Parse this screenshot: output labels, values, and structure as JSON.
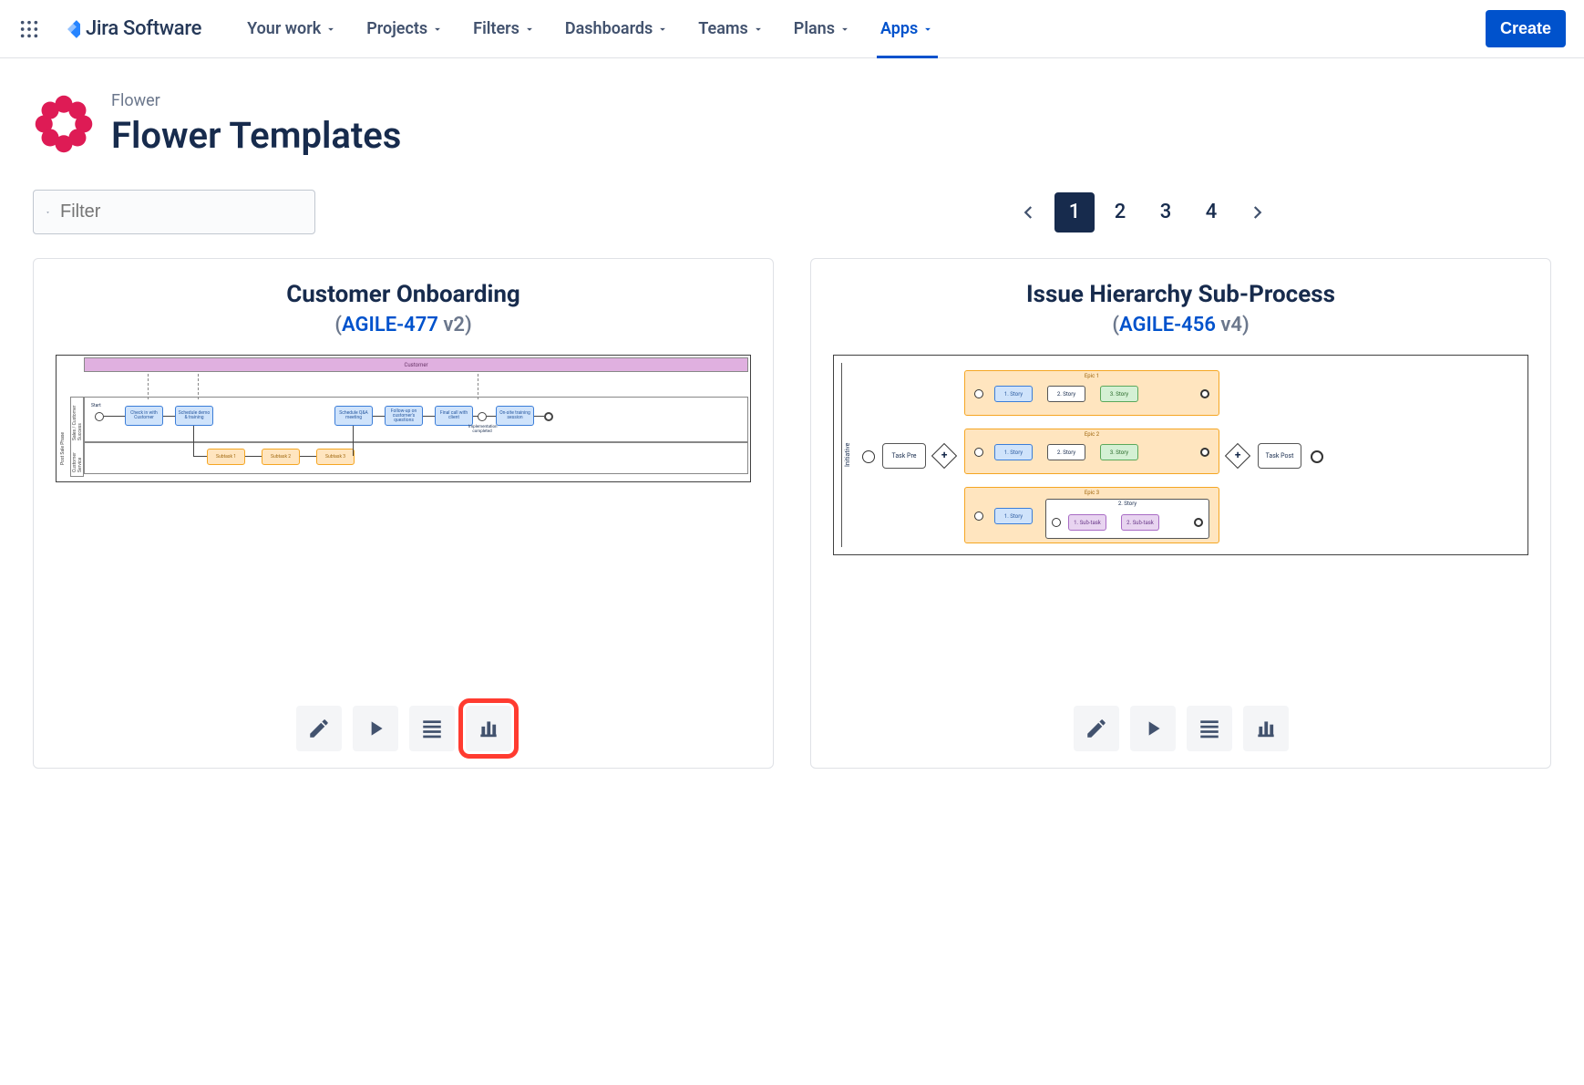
{
  "nav": {
    "product": "Jira Software",
    "items": [
      "Your work",
      "Projects",
      "Filters",
      "Dashboards",
      "Teams",
      "Plans",
      "Apps"
    ],
    "active_index": 6,
    "create": "Create"
  },
  "page": {
    "breadcrumb": "Flower",
    "title": "Flower Templates"
  },
  "filter": {
    "placeholder": "Filter"
  },
  "pagination": {
    "pages": [
      "1",
      "2",
      "3",
      "4"
    ],
    "current": 0
  },
  "cards": [
    {
      "title": "Customer Onboarding",
      "issue_key": "AGILE-477",
      "version": "v2",
      "diagram": {
        "pool_top": "Customer",
        "outer_lane": "Post Sale Phase",
        "lane1": "Sales / Customer Success",
        "lane2": "Customer Service",
        "start": "Start",
        "blue_nodes": [
          "Check in with Customer",
          "Schedule demo & training",
          "Schedule Q&A meeting",
          "Follow-up on customer's questions",
          "Final call with client",
          "On-site training session"
        ],
        "orange_nodes": [
          "Subtask 1",
          "Subtask 2",
          "Subtask 3"
        ],
        "annotation": "Implementation completed"
      }
    },
    {
      "title": "Issue Hierarchy Sub-Process",
      "issue_key": "AGILE-456",
      "version": "v4",
      "diagram": {
        "lane": "Initiative",
        "task_pre": "Task Pre",
        "task_post": "Task Post",
        "epics": [
          {
            "name": "Epic 1",
            "stories": [
              {
                "l": "1. Story",
                "c": "blue"
              },
              {
                "l": "2. Story",
                "c": "white"
              },
              {
                "l": "3. Story",
                "c": "green"
              }
            ]
          },
          {
            "name": "Epic 2",
            "stories": [
              {
                "l": "1. Story",
                "c": "blue"
              },
              {
                "l": "2. Story",
                "c": "white"
              },
              {
                "l": "3. Story",
                "c": "green"
              }
            ]
          },
          {
            "name": "Epic 3",
            "stories": [
              {
                "l": "1. Story",
                "c": "blue"
              }
            ],
            "nested": {
              "label": "2. Story",
              "subtasks": [
                {
                  "l": "1. Sub-task",
                  "c": "purple"
                },
                {
                  "l": "2. Sub-task",
                  "c": "purple"
                }
              ]
            }
          }
        ]
      }
    }
  ],
  "actions": [
    "edit",
    "run",
    "list",
    "chart"
  ]
}
